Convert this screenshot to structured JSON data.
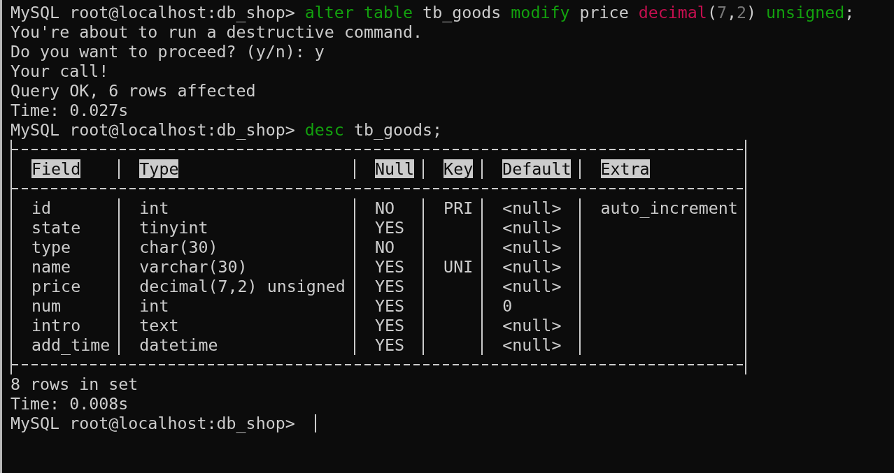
{
  "terminal": {
    "lines_before": [
      {
        "kind": "command",
        "prompt": "MySQL root@localhost:db_shop>",
        "segments": [
          {
            "kind": "keyword",
            "text": "alter table"
          },
          {
            "kind": "plain",
            "text": " tb_goods "
          },
          {
            "kind": "keyword",
            "text": "modify"
          },
          {
            "kind": "plain",
            "text": " price "
          },
          {
            "kind": "type",
            "text": "decimal"
          },
          {
            "kind": "plain",
            "text": "("
          },
          {
            "kind": "number",
            "text": "7"
          },
          {
            "kind": "plain",
            "text": ","
          },
          {
            "kind": "number",
            "text": "2"
          },
          {
            "kind": "plain",
            "text": ") "
          },
          {
            "kind": "keyword",
            "text": "unsigned"
          },
          {
            "kind": "plain",
            "text": ";"
          }
        ]
      },
      {
        "kind": "output",
        "text": "You're about to run a destructive command."
      },
      {
        "kind": "output",
        "text": "Do you want to proceed? (y/n): y"
      },
      {
        "kind": "output",
        "text": "Your call!"
      },
      {
        "kind": "output",
        "text": "Query OK, 6 rows affected"
      },
      {
        "kind": "output",
        "text": "Time: 0.027s"
      },
      {
        "kind": "command",
        "prompt": "MySQL root@localhost:db_shop>",
        "segments": [
          {
            "kind": "keyword",
            "text": "desc"
          },
          {
            "kind": "plain",
            "text": " tb_goods;"
          }
        ]
      }
    ],
    "table": {
      "columns": [
        "Field",
        "Type",
        "Null",
        "Key",
        "Default",
        "Extra"
      ],
      "rows": [
        [
          "id",
          "int",
          "NO",
          "PRI",
          "<null>",
          "auto_increment"
        ],
        [
          "state",
          "tinyint",
          "YES",
          "",
          "<null>",
          ""
        ],
        [
          "type",
          "char(30)",
          "NO",
          "",
          "<null>",
          ""
        ],
        [
          "name",
          "varchar(30)",
          "YES",
          "UNI",
          "<null>",
          ""
        ],
        [
          "price",
          "decimal(7,2) unsigned",
          "YES",
          "",
          "<null>",
          ""
        ],
        [
          "num",
          "int",
          "YES",
          "",
          "0",
          ""
        ],
        [
          "intro",
          "text",
          "YES",
          "",
          "<null>",
          ""
        ],
        [
          "add_time",
          "datetime",
          "YES",
          "",
          "<null>",
          ""
        ]
      ]
    },
    "lines_after": [
      {
        "kind": "output",
        "text": "8 rows in set"
      },
      {
        "kind": "output",
        "text": "Time: 0.008s"
      },
      {
        "kind": "command",
        "prompt": "MySQL root@localhost:db_shop>"
      }
    ]
  }
}
